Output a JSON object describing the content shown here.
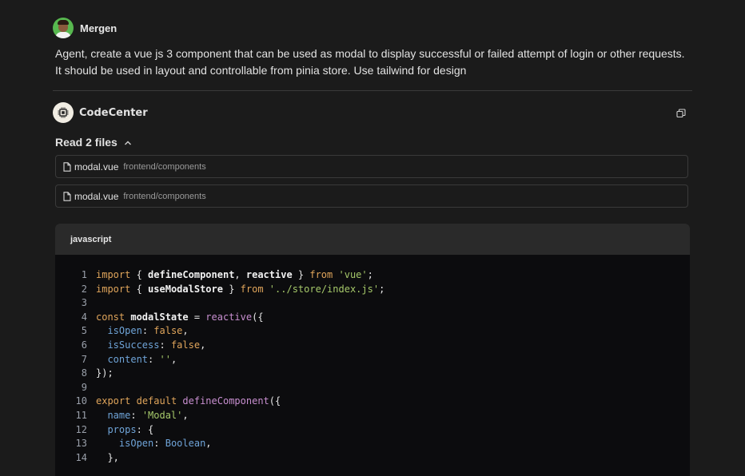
{
  "user_message": {
    "author": "Mergen",
    "lines": [
      "Agent, create a vue js 3 component that can be used as modal to display successful or failed attempt of login or other requests.",
      "It should be used in layout and controllable from pinia store. Use tailwind for design"
    ]
  },
  "agent": {
    "name": "CodeCenter",
    "copy_icon": "copy-icon",
    "read_files_label": "Read 2 files",
    "files": [
      {
        "name": "modal.vue",
        "path": "frontend/components"
      },
      {
        "name": "modal.vue",
        "path": "frontend/components"
      }
    ]
  },
  "code": {
    "language": "javascript",
    "colors": {
      "keyword": "#e0a55b",
      "string": "#a6c96a",
      "property": "#6fa4d8",
      "function": "#c88fd0"
    },
    "lines": [
      {
        "n": "1",
        "tokens": [
          [
            "kw",
            "import"
          ],
          [
            "p",
            " { "
          ],
          [
            "id",
            "defineComponent"
          ],
          [
            "p",
            ", "
          ],
          [
            "id",
            "reactive"
          ],
          [
            "p",
            " } "
          ],
          [
            "kw",
            "from"
          ],
          [
            "p",
            " "
          ],
          [
            "str",
            "'vue'"
          ],
          [
            "p",
            ";"
          ]
        ]
      },
      {
        "n": "2",
        "tokens": [
          [
            "kw",
            "import"
          ],
          [
            "p",
            " { "
          ],
          [
            "id",
            "useModalStore"
          ],
          [
            "p",
            " } "
          ],
          [
            "kw",
            "from"
          ],
          [
            "p",
            " "
          ],
          [
            "str",
            "'../store/index.js'"
          ],
          [
            "p",
            ";"
          ]
        ]
      },
      {
        "n": "3",
        "tokens": []
      },
      {
        "n": "4",
        "tokens": [
          [
            "kw",
            "const"
          ],
          [
            "p",
            " "
          ],
          [
            "id",
            "modalState"
          ],
          [
            "p",
            " = "
          ],
          [
            "fn",
            "reactive"
          ],
          [
            "p",
            "({"
          ]
        ]
      },
      {
        "n": "5",
        "tokens": [
          [
            "p",
            "  "
          ],
          [
            "prop",
            "isOpen"
          ],
          [
            "p",
            ": "
          ],
          [
            "kw",
            "false"
          ],
          [
            "p",
            ","
          ]
        ]
      },
      {
        "n": "6",
        "tokens": [
          [
            "p",
            "  "
          ],
          [
            "prop",
            "isSuccess"
          ],
          [
            "p",
            ": "
          ],
          [
            "kw",
            "false"
          ],
          [
            "p",
            ","
          ]
        ]
      },
      {
        "n": "7",
        "tokens": [
          [
            "p",
            "  "
          ],
          [
            "prop",
            "content"
          ],
          [
            "p",
            ": "
          ],
          [
            "str",
            "''"
          ],
          [
            "p",
            ","
          ]
        ]
      },
      {
        "n": "8",
        "tokens": [
          [
            "p",
            "});"
          ]
        ]
      },
      {
        "n": "9",
        "tokens": []
      },
      {
        "n": "10",
        "tokens": [
          [
            "kw",
            "export"
          ],
          [
            "p",
            " "
          ],
          [
            "kw",
            "default"
          ],
          [
            "p",
            " "
          ],
          [
            "fn",
            "defineComponent"
          ],
          [
            "p",
            "({"
          ]
        ]
      },
      {
        "n": "11",
        "tokens": [
          [
            "p",
            "  "
          ],
          [
            "prop",
            "name"
          ],
          [
            "p",
            ": "
          ],
          [
            "str",
            "'Modal'"
          ],
          [
            "p",
            ","
          ]
        ]
      },
      {
        "n": "12",
        "tokens": [
          [
            "p",
            "  "
          ],
          [
            "prop",
            "props"
          ],
          [
            "p",
            ": {"
          ]
        ]
      },
      {
        "n": "13",
        "tokens": [
          [
            "p",
            "    "
          ],
          [
            "prop",
            "isOpen"
          ],
          [
            "p",
            ": "
          ],
          [
            "prop",
            "Boolean"
          ],
          [
            "p",
            ","
          ]
        ]
      },
      {
        "n": "14",
        "tokens": [
          [
            "p",
            "  },"
          ]
        ]
      }
    ]
  }
}
